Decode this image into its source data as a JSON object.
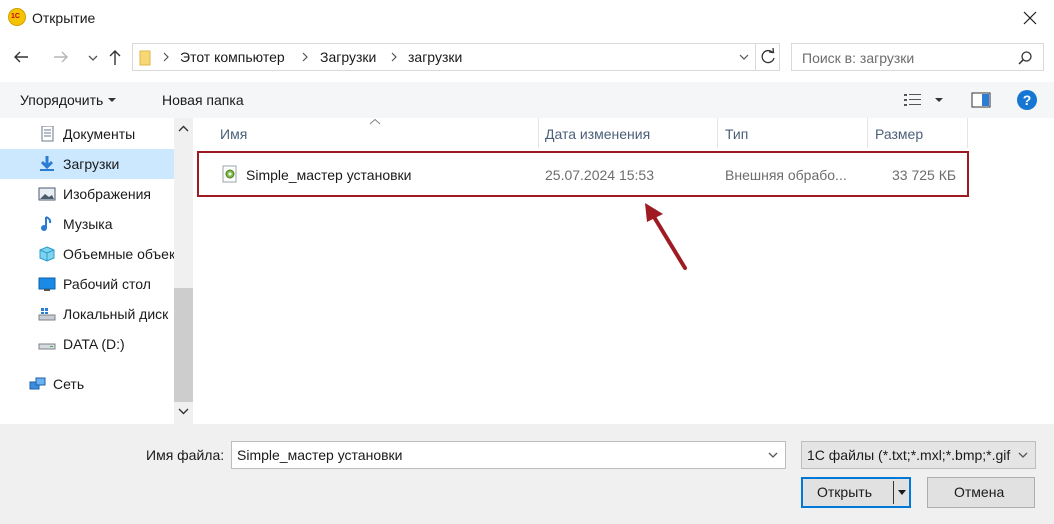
{
  "window": {
    "title": "Открытие",
    "app_icon_text": "1C"
  },
  "address": {
    "crumbs": [
      "Этот компьютер",
      "Загрузки",
      "загрузки"
    ]
  },
  "search": {
    "placeholder": "Поиск в: загрузки"
  },
  "toolbar": {
    "organize": "Упорядочить",
    "new_folder": "Новая папка"
  },
  "sidebar": {
    "items": [
      {
        "label": "Документы",
        "icon": "documents-icon"
      },
      {
        "label": "Загрузки",
        "icon": "downloads-icon",
        "selected": true
      },
      {
        "label": "Изображения",
        "icon": "pictures-icon"
      },
      {
        "label": "Музыка",
        "icon": "music-icon"
      },
      {
        "label": "Объемные объекты",
        "icon": "3d-objects-icon"
      },
      {
        "label": "Рабочий стол",
        "icon": "desktop-icon"
      },
      {
        "label": "Локальный диск",
        "icon": "local-disk-icon"
      },
      {
        "label": "DATA (D:)",
        "icon": "drive-icon"
      },
      {
        "label": "Сеть",
        "icon": "network-icon"
      }
    ]
  },
  "columns": {
    "name": "Имя",
    "date": "Дата изменения",
    "type": "Тип",
    "size": "Размер"
  },
  "files": [
    {
      "name": "Simple_мастер установки",
      "date": "25.07.2024 15:53",
      "type": "Внешняя обрабо...",
      "size": "33 725 КБ"
    }
  ],
  "footer": {
    "filename_label": "Имя файла:",
    "filename_value": "Simple_мастер установки",
    "filetype": "1С файлы (*.txt;*.mxl;*.bmp;*.gif",
    "open": "Открыть",
    "cancel": "Отмена"
  },
  "colors": {
    "accent": "#0078d7",
    "highlight": "#9e1b22",
    "selection": "#cce8ff"
  }
}
